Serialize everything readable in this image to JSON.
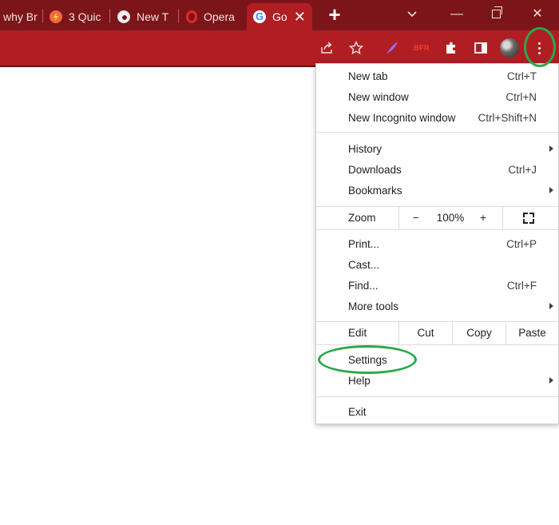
{
  "tabs": [
    {
      "title": "why Br",
      "favicon": "none"
    },
    {
      "title": "3 Quic",
      "favicon": "bolt-icon"
    },
    {
      "title": "New T",
      "favicon": "chrome-icon"
    },
    {
      "title": "Opera",
      "favicon": "opera-icon"
    },
    {
      "title": "Go",
      "favicon": "google-icon",
      "active": true,
      "close": "✕"
    }
  ],
  "tabstrip": {
    "new_tab": "+",
    "min": "—",
    "close": "✕",
    "dropdown": "⌄"
  },
  "toolbar": {
    "extension_badge": "BFR"
  },
  "menu": {
    "new_tab": {
      "label": "New tab",
      "shortcut": "Ctrl+T"
    },
    "new_window": {
      "label": "New window",
      "shortcut": "Ctrl+N"
    },
    "new_incognito": {
      "label": "New Incognito window",
      "shortcut": "Ctrl+Shift+N"
    },
    "history": {
      "label": "History"
    },
    "downloads": {
      "label": "Downloads",
      "shortcut": "Ctrl+J"
    },
    "bookmarks": {
      "label": "Bookmarks"
    },
    "zoom": {
      "label": "Zoom",
      "minus": "−",
      "value": "100%",
      "plus": "+"
    },
    "print": {
      "label": "Print...",
      "shortcut": "Ctrl+P"
    },
    "cast": {
      "label": "Cast..."
    },
    "find": {
      "label": "Find...",
      "shortcut": "Ctrl+F"
    },
    "more_tools": {
      "label": "More tools"
    },
    "edit": {
      "label": "Edit",
      "cut": "Cut",
      "copy": "Copy",
      "paste": "Paste"
    },
    "settings": {
      "label": "Settings"
    },
    "help": {
      "label": "Help"
    },
    "exit": {
      "label": "Exit"
    }
  },
  "colors": {
    "tabstrip": "#7c1519",
    "toolbar": "#b01e24",
    "highlight": "#2aa84a"
  }
}
